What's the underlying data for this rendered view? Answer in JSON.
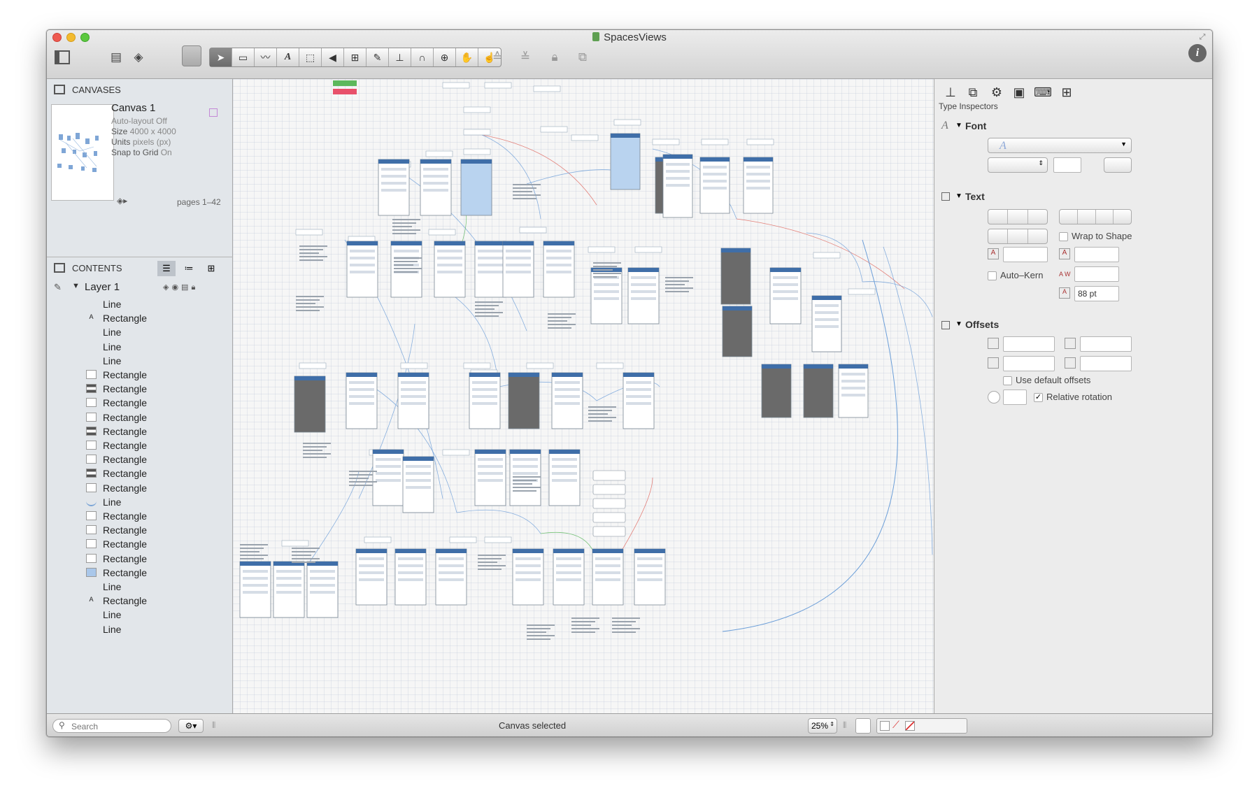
{
  "window": {
    "title": "SpacesViews"
  },
  "toolbar": {
    "left_icons": [
      "sidebar-toggle-icon",
      "layers-icon",
      "stencil-icon"
    ],
    "tools": [
      "selection-tool-icon",
      "shape-tool-icon",
      "line-tool-icon",
      "text-tool-icon",
      "pen-tool-icon",
      "diagram-tool-icon",
      "style-brush-icon",
      "rubber-stamp-icon",
      "magnet-icon",
      "zoom-icon",
      "hand-icon",
      "browse-icon"
    ],
    "right_icons": [
      "bring-front-icon",
      "send-back-icon",
      "lock-icon",
      "group-icon"
    ],
    "info_icon": "i"
  },
  "canvases": {
    "header": "CANVASES",
    "name": "Canvas 1",
    "autolayout_label": "Auto-layout",
    "autolayout_value": "Off",
    "size_label": "Size",
    "size_value": "4000 x 4000",
    "units_label": "Units",
    "units_value": "pixels (px)",
    "snap_label": "Snap to Grid",
    "snap_value": "On",
    "pages": "pages 1–42"
  },
  "contents": {
    "header": "CONTENTS",
    "layer": "Layer 1",
    "items": [
      {
        "label": "Line",
        "icon": "none"
      },
      {
        "label": "Rectangle",
        "icon": "A"
      },
      {
        "label": "Line",
        "icon": "none"
      },
      {
        "label": "Line",
        "icon": "none"
      },
      {
        "label": "Line",
        "icon": "none"
      },
      {
        "label": "Rectangle",
        "icon": "thumb"
      },
      {
        "label": "Rectangle",
        "icon": "dark"
      },
      {
        "label": "Rectangle",
        "icon": "thumb"
      },
      {
        "label": "Rectangle",
        "icon": "thumb"
      },
      {
        "label": "Rectangle",
        "icon": "dark"
      },
      {
        "label": "Rectangle",
        "icon": "thumb"
      },
      {
        "label": "Rectangle",
        "icon": "thumb"
      },
      {
        "label": "Rectangle",
        "icon": "dark"
      },
      {
        "label": "Rectangle",
        "icon": "thumb"
      },
      {
        "label": "Line",
        "icon": "curve"
      },
      {
        "label": "Rectangle",
        "icon": "thumb"
      },
      {
        "label": "Rectangle",
        "icon": "thumb"
      },
      {
        "label": "Rectangle",
        "icon": "thumb"
      },
      {
        "label": "Rectangle",
        "icon": "thumb"
      },
      {
        "label": "Rectangle",
        "icon": "blue"
      },
      {
        "label": "Line",
        "icon": "none"
      },
      {
        "label": "Rectangle",
        "icon": "A"
      },
      {
        "label": "Line",
        "icon": "none"
      },
      {
        "label": "Line",
        "icon": "none"
      }
    ]
  },
  "inspector": {
    "title": "Type Inspectors",
    "font_section": "Font",
    "text_section": "Text",
    "wrap_to_shape": "Wrap to Shape",
    "auto_kern": "Auto–Kern",
    "line_spacing": "88 pt",
    "offsets_section": "Offsets",
    "use_default_offsets": "Use default offsets",
    "relative_rotation": "Relative rotation"
  },
  "statusbar": {
    "search_placeholder": "Search",
    "status": "Canvas selected",
    "zoom": "25%"
  },
  "colors": {
    "accent": "#3b7fd6",
    "canvas_line": "#6b9ed8",
    "red_line": "#e0645a",
    "green_line": "#5cb85c"
  }
}
